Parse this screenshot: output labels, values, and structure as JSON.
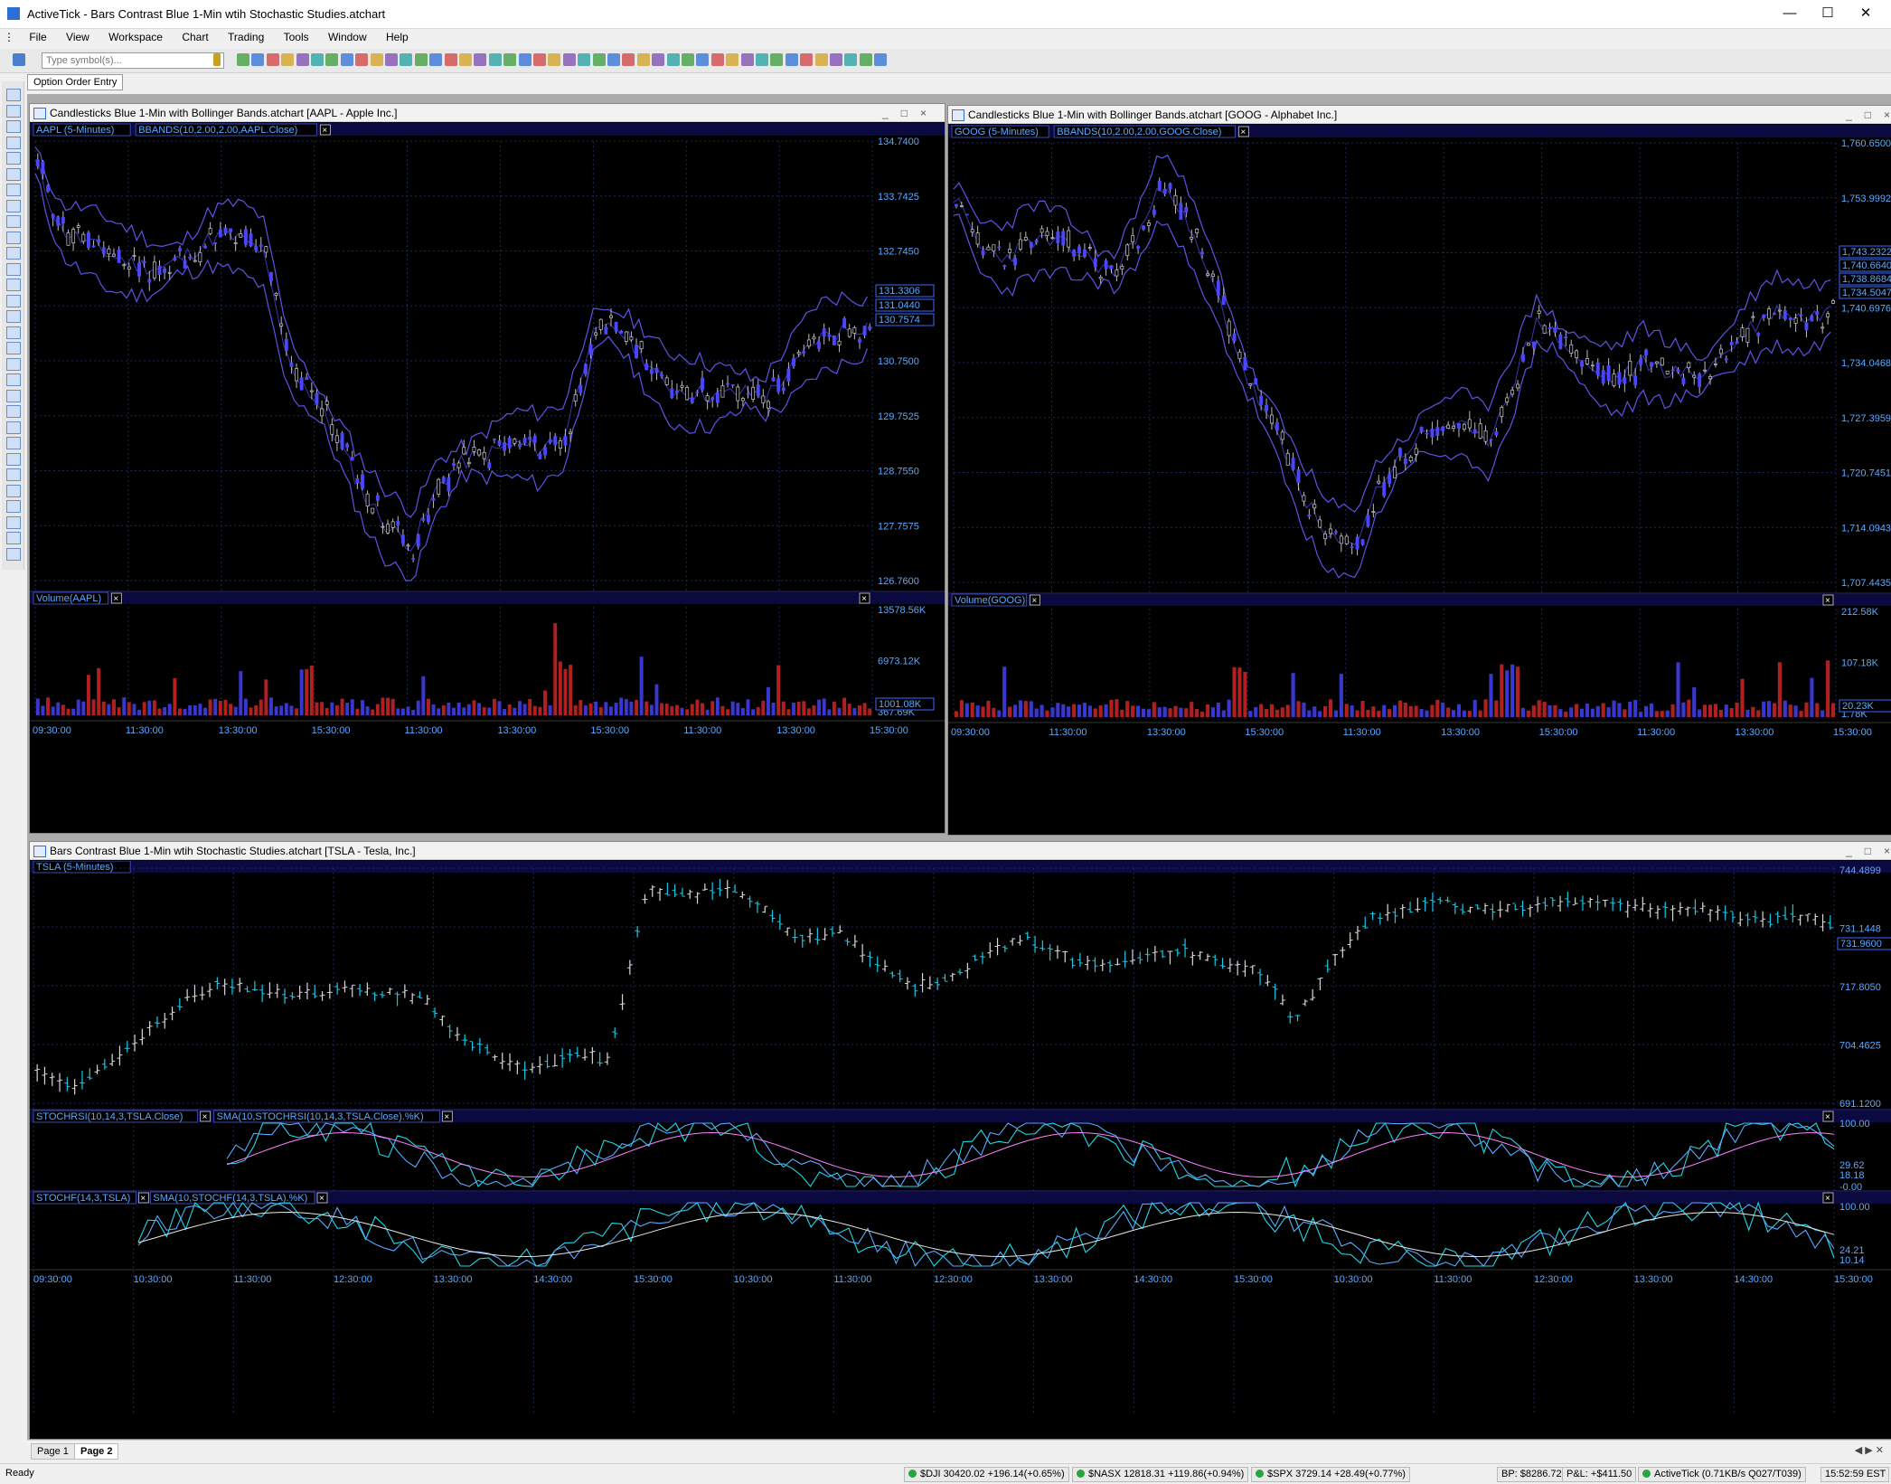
{
  "window": {
    "title": "ActiveTick - Bars Contrast Blue 1-Min wtih Stochastic Studies.atchart"
  },
  "menu": [
    "File",
    "View",
    "Workspace",
    "Chart",
    "Trading",
    "Tools",
    "Window",
    "Help"
  ],
  "toolbar": {
    "symbol_placeholder": "Type symbol(s)..."
  },
  "option_order_entry": "Option Order Entry",
  "colors": {
    "bg": "#000000",
    "band": "#5a54e6",
    "candle_up": "#4a46ff",
    "bar": "#d8d8d8",
    "tsla_tick": "#18c8e8",
    "stoch_a": "#20d8e8",
    "stoch_b": "#5aa8ff",
    "stoch_sma": "#ff80ff",
    "grid": "#1a2a5a"
  },
  "charts": {
    "aapl": {
      "window_title": "Candlesticks Blue 1-Min with Bollinger Bands.atchart [AAPL - Apple Inc.]",
      "tag_symbol": "AAPL (5-Minutes)",
      "tag_study": "BBANDS(10,2.00,2.00,AAPL.Close)",
      "price_ticks": [
        "134.7400",
        "133.7425",
        "132.7450",
        "131.7475",
        "130.7500",
        "129.7525",
        "128.7550",
        "127.7575",
        "126.7600"
      ],
      "price_labels": [
        "131.3306",
        "131.0440",
        "130.7574"
      ],
      "vol_tag": "Volume(AAPL)",
      "vol_ticks": [
        "13578.56K",
        "6973.12K",
        "367.69K"
      ],
      "vol_label": "1001.08K",
      "time_ticks": [
        "09:30:00",
        "11:30:00",
        "13:30:00",
        "15:30:00",
        "11:30:00",
        "13:30:00",
        "15:30:00",
        "11:30:00",
        "13:30:00",
        "15:30:00"
      ]
    },
    "goog": {
      "window_title": "Candlesticks Blue 1-Min with Bollinger Bands.atchart [GOOG - Alphabet Inc.]",
      "tag_symbol": "GOOG (5-Minutes)",
      "tag_study": "BBANDS(10,2.00,2.00,GOOG.Close)",
      "price_ticks": [
        "1,760.6500",
        "1,753.9992",
        "1,747.3484",
        "1,740.6976",
        "1,734.0468",
        "1,727.3959",
        "1,720.7451",
        "1,714.0943",
        "1,707.4435"
      ],
      "price_labels": [
        "1,743.2322",
        "1,740.6640",
        "1,738.8684",
        "1,734.5047"
      ],
      "vol_tag": "Volume(GOOG)",
      "vol_ticks": [
        "212.58K",
        "107.18K",
        "1.78K"
      ],
      "vol_label": "20.23K",
      "time_ticks": [
        "09:30:00",
        "11:30:00",
        "13:30:00",
        "15:30:00",
        "11:30:00",
        "13:30:00",
        "15:30:00",
        "11:30:00",
        "13:30:00",
        "15:30:00"
      ]
    },
    "tsla": {
      "window_title": "Bars Contrast Blue 1-Min wtih Stochastic Studies.atchart [TSLA - Tesla, Inc.]",
      "tag_symbol": "TSLA (5-Minutes)",
      "price_ticks": [
        "744.4899",
        "731.1448",
        "717.8050",
        "704.4625",
        "691.1200"
      ],
      "price_label": "731.9600",
      "stochrsi_tag": "STOCHRSI(10,14,3,TSLA.Close)",
      "stochrsi_sma_tag": "SMA(10,STOCHRSI(10,14,3,TSLA.Close).%K)",
      "stochrsi_ticks": [
        "100.00",
        "-0.00"
      ],
      "stochrsi_labels": [
        "29.62",
        "18.18"
      ],
      "stochf_tag": "STOCHF(14,3,TSLA)",
      "stochf_sma_tag": "SMA(10,STOCHF(14,3,TSLA).%K)",
      "stochf_ticks": [
        "100.00"
      ],
      "stochf_labels": [
        "24.21",
        "10.14"
      ],
      "time_ticks": [
        "09:30:00",
        "10:30:00",
        "11:30:00",
        "12:30:00",
        "13:30:00",
        "14:30:00",
        "15:30:00",
        "10:30:00",
        "11:30:00",
        "12:30:00",
        "13:30:00",
        "14:30:00",
        "15:30:00",
        "10:30:00",
        "11:30:00",
        "12:30:00",
        "13:30:00",
        "14:30:00",
        "15:30:00"
      ]
    }
  },
  "tabs": [
    "Page 1",
    "Page 2"
  ],
  "status": {
    "ready": "Ready",
    "djia": "$DJI 30420.02 +196.14(+0.65%)",
    "nasx": "$NASX 12818.31 +119.86(+0.94%)",
    "spx": "$SPX 3729.14 +28.49(+0.77%)",
    "bp": "BP: $8286.72",
    "pnl": "P&L: +$411.50",
    "feed": "ActiveTick (0.71KB/s Q027/T039)",
    "clock": "15:52:59 EST"
  }
}
